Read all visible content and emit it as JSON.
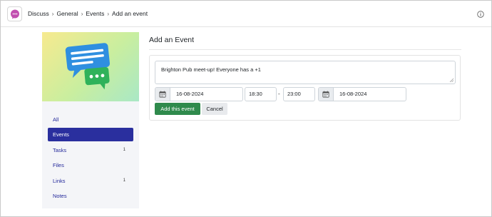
{
  "header": {
    "app_icon": "chat-bubble-icon",
    "breadcrumb": [
      "Discuss",
      "General",
      "Events",
      "Add an event"
    ],
    "separator": "›",
    "info_icon": "info-circle-icon"
  },
  "sidebar": {
    "hero_icon": "chat-messages-illustration",
    "items": [
      {
        "label": "All",
        "count": ""
      },
      {
        "label": "Events",
        "count": "",
        "active": true
      },
      {
        "label": "Tasks",
        "count": "1"
      },
      {
        "label": "Files",
        "count": ""
      },
      {
        "label": "Links",
        "count": "1"
      },
      {
        "label": "Notes",
        "count": ""
      }
    ]
  },
  "main": {
    "title": "Add an Event",
    "description": "Brighton Pub meet-up! Everyone has a +1",
    "start_date": "16-08-2024",
    "start_time": "18:30",
    "time_separator": "-",
    "end_time": "23:00",
    "end_date": "16-08-2024",
    "add_button": "Add this event",
    "cancel_button": "Cancel",
    "calendar_icon": "calendar-icon"
  },
  "colors": {
    "accent": "#2a2f9e",
    "success": "#2f8a4c",
    "sidebar_bg": "#f4f5f8",
    "app_icon": "#c24fb0"
  }
}
